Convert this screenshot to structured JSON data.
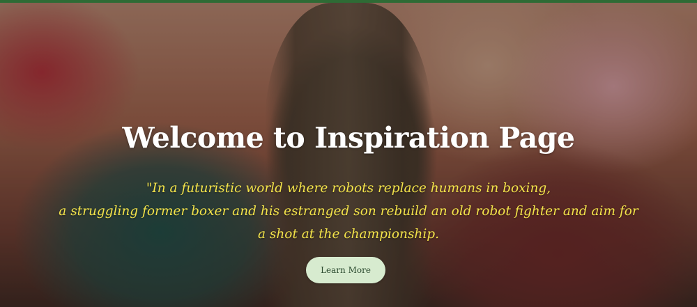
{
  "hero": {
    "title": "Welcome to Inspiration Page",
    "quote_lines": [
      "\"In a futuristic world where robots replace humans in boxing,",
      "a struggling former boxer and his estranged son rebuild an old robot fighter and aim for",
      "a shot at the championship."
    ],
    "button_label": "Learn More"
  },
  "colors": {
    "title": "#ffffff",
    "quote": "#f3e34a",
    "button_bg": "#d7ebcf",
    "button_text": "#2b4a2f",
    "top_bar": "#2e6b35"
  }
}
